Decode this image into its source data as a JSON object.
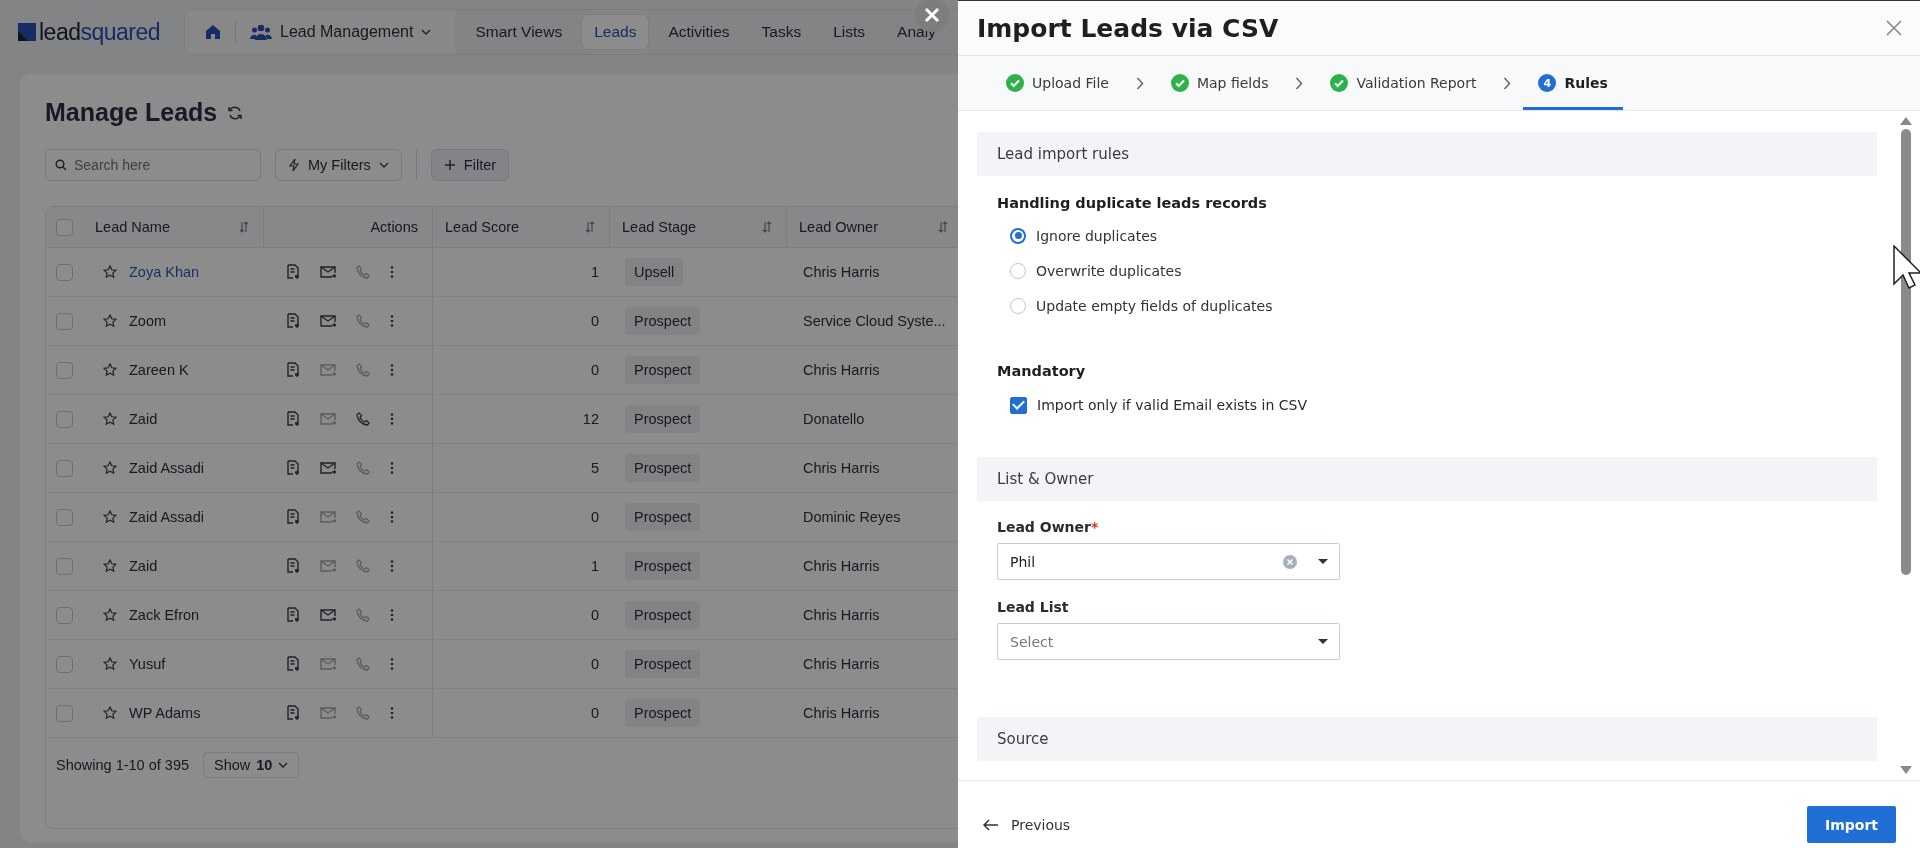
{
  "app": {
    "logo": [
      "lead",
      "squared"
    ],
    "module": "Lead Management",
    "nav_items": [
      {
        "label": "Smart Views",
        "selected": false
      },
      {
        "label": "Leads",
        "selected": true
      },
      {
        "label": "Activities",
        "selected": false
      },
      {
        "label": "Tasks",
        "selected": false
      },
      {
        "label": "Lists",
        "selected": false
      },
      {
        "label": "Analy",
        "selected": false
      }
    ],
    "page_title": "Manage Leads",
    "search": {
      "placeholder": "Search here"
    },
    "my_filters": "My Filters",
    "filter": "Filter",
    "table": {
      "all_checked": false,
      "columns": [
        "Lead Name",
        "Actions",
        "Lead Score",
        "Lead Stage",
        "Lead Owner"
      ],
      "rows": [
        {
          "checked": false,
          "name": "Zoya Khan",
          "highlighted": true,
          "score": "1",
          "stage": "Upsell",
          "owner": "Chris Harris",
          "email_enabled": true,
          "phone_enabled": false
        },
        {
          "checked": false,
          "name": "Zoom",
          "highlighted": false,
          "score": "0",
          "stage": "Prospect",
          "owner": "Service Cloud Syste...",
          "email_enabled": true,
          "phone_enabled": false
        },
        {
          "checked": false,
          "name": "Zareen K",
          "highlighted": false,
          "score": "0",
          "stage": "Prospect",
          "owner": "Chris Harris",
          "email_enabled": false,
          "phone_enabled": false
        },
        {
          "checked": false,
          "name": "Zaid",
          "highlighted": false,
          "score": "12",
          "stage": "Prospect",
          "owner": "Donatello",
          "email_enabled": false,
          "phone_enabled": true
        },
        {
          "checked": false,
          "name": "Zaid Assadi",
          "highlighted": false,
          "score": "5",
          "stage": "Prospect",
          "owner": "Chris Harris",
          "email_enabled": true,
          "phone_enabled": false
        },
        {
          "checked": false,
          "name": "Zaid Assadi",
          "highlighted": false,
          "score": "0",
          "stage": "Prospect",
          "owner": "Dominic Reyes",
          "email_enabled": false,
          "phone_enabled": false
        },
        {
          "checked": false,
          "name": "Zaid",
          "highlighted": false,
          "score": "1",
          "stage": "Prospect",
          "owner": "Chris Harris",
          "email_enabled": false,
          "phone_enabled": false
        },
        {
          "checked": false,
          "name": "Zack Efron",
          "highlighted": false,
          "score": "0",
          "stage": "Prospect",
          "owner": "Chris Harris",
          "email_enabled": true,
          "phone_enabled": false
        },
        {
          "checked": false,
          "name": "Yusuf",
          "highlighted": false,
          "score": "0",
          "stage": "Prospect",
          "owner": "Chris Harris",
          "email_enabled": false,
          "phone_enabled": false
        },
        {
          "checked": false,
          "name": "WP Adams",
          "highlighted": false,
          "score": "0",
          "stage": "Prospect",
          "owner": "Chris Harris",
          "email_enabled": false,
          "phone_enabled": false
        }
      ],
      "summary": "Showing 1-10 of 395",
      "page_size": {
        "label": "Show",
        "value": "10"
      }
    }
  },
  "panel": {
    "title": "Import Leads via CSV",
    "steps": [
      {
        "label": "Upload File",
        "kind": "done",
        "selected": false
      },
      {
        "label": "Map fields",
        "kind": "done",
        "selected": false
      },
      {
        "label": "Validation Report",
        "kind": "done",
        "selected": false
      },
      {
        "label": "Rules",
        "kind": "current",
        "number": "4",
        "selected": true
      }
    ],
    "rules_section": {
      "title": "Lead import rules",
      "duplicates_heading": "Handling duplicate leads records",
      "options": [
        {
          "label": "Ignore duplicates",
          "selected": true
        },
        {
          "label": "Overwrite duplicates",
          "selected": false
        },
        {
          "label": "Update empty fields of duplicates",
          "selected": false
        }
      ],
      "mandatory_heading": "Mandatory",
      "mandatory_option": {
        "label": "Import only if valid Email exists in CSV",
        "checked": true
      }
    },
    "owner_section": {
      "title": "List & Owner",
      "fields": [
        {
          "label": "Lead Owner",
          "required_mark": "*",
          "value": "Phil",
          "clearable": true
        },
        {
          "label": "Lead List",
          "placeholder": "Select",
          "clearable": false
        }
      ]
    },
    "source_section": {
      "title": "Source"
    },
    "previous": "Previous",
    "import": "Import"
  }
}
